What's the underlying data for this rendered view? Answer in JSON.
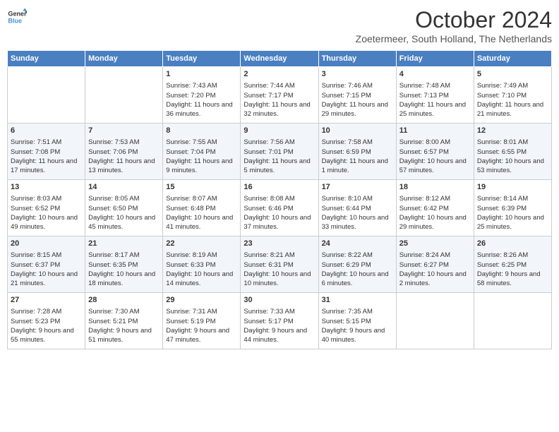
{
  "header": {
    "logo_line1": "General",
    "logo_line2": "Blue",
    "month": "October 2024",
    "location": "Zoetermeer, South Holland, The Netherlands"
  },
  "weekdays": [
    "Sunday",
    "Monday",
    "Tuesday",
    "Wednesday",
    "Thursday",
    "Friday",
    "Saturday"
  ],
  "weeks": [
    [
      {
        "day": "",
        "sunrise": "",
        "sunset": "",
        "daylight": ""
      },
      {
        "day": "",
        "sunrise": "",
        "sunset": "",
        "daylight": ""
      },
      {
        "day": "1",
        "sunrise": "Sunrise: 7:43 AM",
        "sunset": "Sunset: 7:20 PM",
        "daylight": "Daylight: 11 hours and 36 minutes."
      },
      {
        "day": "2",
        "sunrise": "Sunrise: 7:44 AM",
        "sunset": "Sunset: 7:17 PM",
        "daylight": "Daylight: 11 hours and 32 minutes."
      },
      {
        "day": "3",
        "sunrise": "Sunrise: 7:46 AM",
        "sunset": "Sunset: 7:15 PM",
        "daylight": "Daylight: 11 hours and 29 minutes."
      },
      {
        "day": "4",
        "sunrise": "Sunrise: 7:48 AM",
        "sunset": "Sunset: 7:13 PM",
        "daylight": "Daylight: 11 hours and 25 minutes."
      },
      {
        "day": "5",
        "sunrise": "Sunrise: 7:49 AM",
        "sunset": "Sunset: 7:10 PM",
        "daylight": "Daylight: 11 hours and 21 minutes."
      }
    ],
    [
      {
        "day": "6",
        "sunrise": "Sunrise: 7:51 AM",
        "sunset": "Sunset: 7:08 PM",
        "daylight": "Daylight: 11 hours and 17 minutes."
      },
      {
        "day": "7",
        "sunrise": "Sunrise: 7:53 AM",
        "sunset": "Sunset: 7:06 PM",
        "daylight": "Daylight: 11 hours and 13 minutes."
      },
      {
        "day": "8",
        "sunrise": "Sunrise: 7:55 AM",
        "sunset": "Sunset: 7:04 PM",
        "daylight": "Daylight: 11 hours and 9 minutes."
      },
      {
        "day": "9",
        "sunrise": "Sunrise: 7:56 AM",
        "sunset": "Sunset: 7:01 PM",
        "daylight": "Daylight: 11 hours and 5 minutes."
      },
      {
        "day": "10",
        "sunrise": "Sunrise: 7:58 AM",
        "sunset": "Sunset: 6:59 PM",
        "daylight": "Daylight: 11 hours and 1 minute."
      },
      {
        "day": "11",
        "sunrise": "Sunrise: 8:00 AM",
        "sunset": "Sunset: 6:57 PM",
        "daylight": "Daylight: 10 hours and 57 minutes."
      },
      {
        "day": "12",
        "sunrise": "Sunrise: 8:01 AM",
        "sunset": "Sunset: 6:55 PM",
        "daylight": "Daylight: 10 hours and 53 minutes."
      }
    ],
    [
      {
        "day": "13",
        "sunrise": "Sunrise: 8:03 AM",
        "sunset": "Sunset: 6:52 PM",
        "daylight": "Daylight: 10 hours and 49 minutes."
      },
      {
        "day": "14",
        "sunrise": "Sunrise: 8:05 AM",
        "sunset": "Sunset: 6:50 PM",
        "daylight": "Daylight: 10 hours and 45 minutes."
      },
      {
        "day": "15",
        "sunrise": "Sunrise: 8:07 AM",
        "sunset": "Sunset: 6:48 PM",
        "daylight": "Daylight: 10 hours and 41 minutes."
      },
      {
        "day": "16",
        "sunrise": "Sunrise: 8:08 AM",
        "sunset": "Sunset: 6:46 PM",
        "daylight": "Daylight: 10 hours and 37 minutes."
      },
      {
        "day": "17",
        "sunrise": "Sunrise: 8:10 AM",
        "sunset": "Sunset: 6:44 PM",
        "daylight": "Daylight: 10 hours and 33 minutes."
      },
      {
        "day": "18",
        "sunrise": "Sunrise: 8:12 AM",
        "sunset": "Sunset: 6:42 PM",
        "daylight": "Daylight: 10 hours and 29 minutes."
      },
      {
        "day": "19",
        "sunrise": "Sunrise: 8:14 AM",
        "sunset": "Sunset: 6:39 PM",
        "daylight": "Daylight: 10 hours and 25 minutes."
      }
    ],
    [
      {
        "day": "20",
        "sunrise": "Sunrise: 8:15 AM",
        "sunset": "Sunset: 6:37 PM",
        "daylight": "Daylight: 10 hours and 21 minutes."
      },
      {
        "day": "21",
        "sunrise": "Sunrise: 8:17 AM",
        "sunset": "Sunset: 6:35 PM",
        "daylight": "Daylight: 10 hours and 18 minutes."
      },
      {
        "day": "22",
        "sunrise": "Sunrise: 8:19 AM",
        "sunset": "Sunset: 6:33 PM",
        "daylight": "Daylight: 10 hours and 14 minutes."
      },
      {
        "day": "23",
        "sunrise": "Sunrise: 8:21 AM",
        "sunset": "Sunset: 6:31 PM",
        "daylight": "Daylight: 10 hours and 10 minutes."
      },
      {
        "day": "24",
        "sunrise": "Sunrise: 8:22 AM",
        "sunset": "Sunset: 6:29 PM",
        "daylight": "Daylight: 10 hours and 6 minutes."
      },
      {
        "day": "25",
        "sunrise": "Sunrise: 8:24 AM",
        "sunset": "Sunset: 6:27 PM",
        "daylight": "Daylight: 10 hours and 2 minutes."
      },
      {
        "day": "26",
        "sunrise": "Sunrise: 8:26 AM",
        "sunset": "Sunset: 6:25 PM",
        "daylight": "Daylight: 9 hours and 58 minutes."
      }
    ],
    [
      {
        "day": "27",
        "sunrise": "Sunrise: 7:28 AM",
        "sunset": "Sunset: 5:23 PM",
        "daylight": "Daylight: 9 hours and 55 minutes."
      },
      {
        "day": "28",
        "sunrise": "Sunrise: 7:30 AM",
        "sunset": "Sunset: 5:21 PM",
        "daylight": "Daylight: 9 hours and 51 minutes."
      },
      {
        "day": "29",
        "sunrise": "Sunrise: 7:31 AM",
        "sunset": "Sunset: 5:19 PM",
        "daylight": "Daylight: 9 hours and 47 minutes."
      },
      {
        "day": "30",
        "sunrise": "Sunrise: 7:33 AM",
        "sunset": "Sunset: 5:17 PM",
        "daylight": "Daylight: 9 hours and 44 minutes."
      },
      {
        "day": "31",
        "sunrise": "Sunrise: 7:35 AM",
        "sunset": "Sunset: 5:15 PM",
        "daylight": "Daylight: 9 hours and 40 minutes."
      },
      {
        "day": "",
        "sunrise": "",
        "sunset": "",
        "daylight": ""
      },
      {
        "day": "",
        "sunrise": "",
        "sunset": "",
        "daylight": ""
      }
    ]
  ]
}
